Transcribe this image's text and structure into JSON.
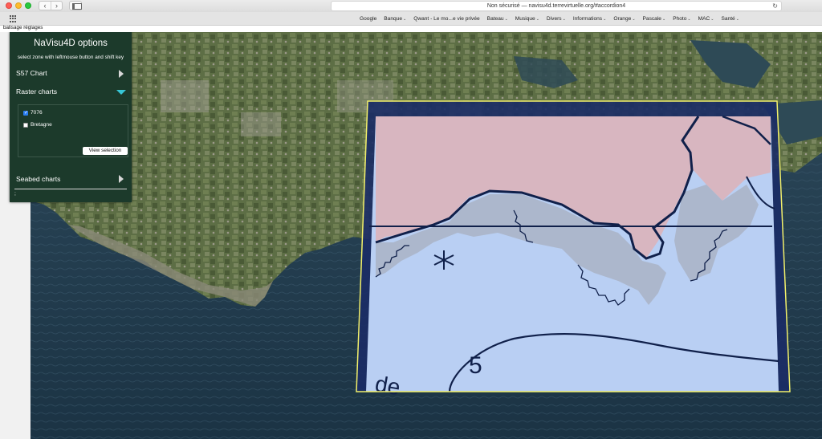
{
  "browser": {
    "url": "Non sécurisé — navisu4d.terrevirtuelle.org/#accordion4",
    "favorites": [
      {
        "label": "Google",
        "has_menu": false
      },
      {
        "label": "Banque",
        "has_menu": true
      },
      {
        "label": "Qwant - Le mo...e vie privée",
        "has_menu": false
      },
      {
        "label": "Bateau",
        "has_menu": true
      },
      {
        "label": "Musique",
        "has_menu": true
      },
      {
        "label": "Divers",
        "has_menu": true
      },
      {
        "label": "Informations",
        "has_menu": true
      },
      {
        "label": "Orange",
        "has_menu": true
      },
      {
        "label": "Pascale",
        "has_menu": true
      },
      {
        "label": "Photo",
        "has_menu": true
      },
      {
        "label": "MAC",
        "has_menu": true
      },
      {
        "label": "Santé",
        "has_menu": true
      }
    ],
    "page_top_text": "balisage réglages"
  },
  "panel": {
    "title": "NaVisu4D options",
    "subtitle": "select zone with leftmouse button and shift key",
    "sections": {
      "s57": "S57 Chart",
      "raster": "Raster charts",
      "seabed": "Seabed charts"
    },
    "raster_items": [
      {
        "label": "7076",
        "checked": true
      },
      {
        "label": "Bretagne",
        "checked": false
      }
    ],
    "view_selection": "View selection",
    "footer_char": ";"
  },
  "chart": {
    "depth_label": "5",
    "text_fragment": "de",
    "colors": {
      "land": "#d8b6c0",
      "water": "#b9cff3",
      "frame": "#1b2c66",
      "selection": "#f2f06a",
      "panel": "#1c3a2b",
      "arrow_open": "#37c6d6"
    }
  }
}
